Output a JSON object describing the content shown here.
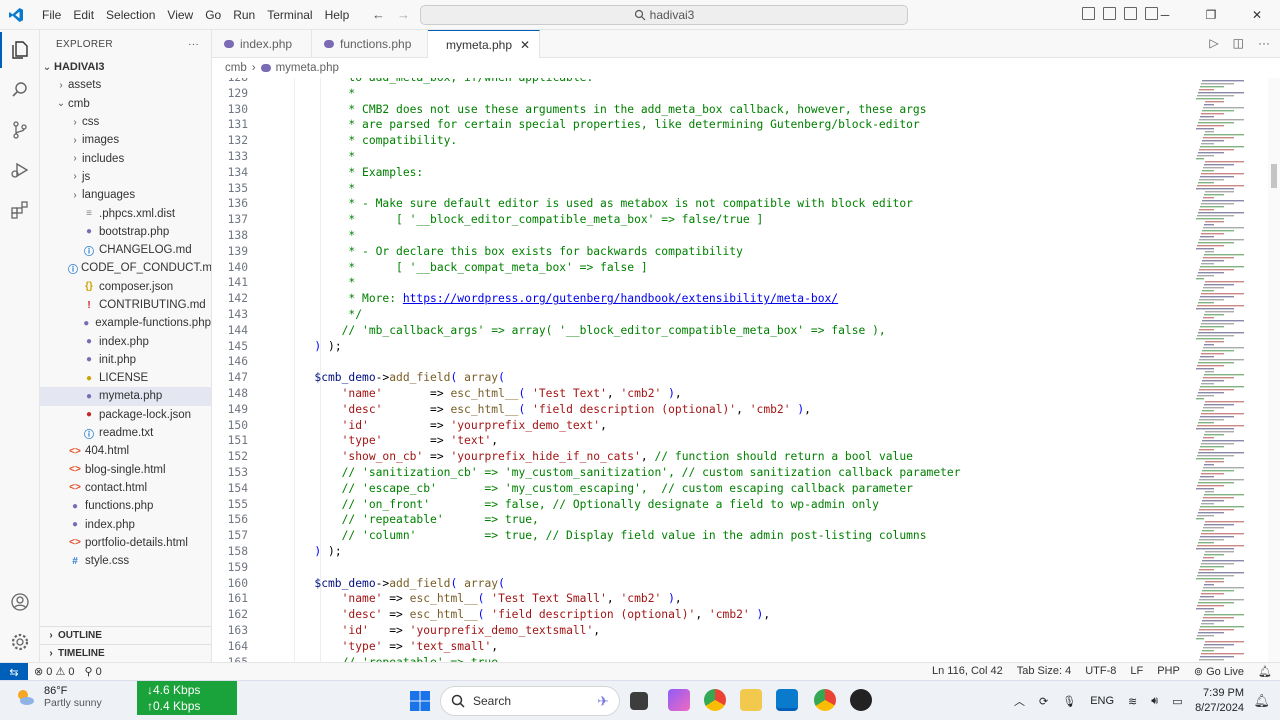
{
  "menu": [
    "File",
    "Edit",
    "Selection",
    "View",
    "Go",
    "Run",
    "Terminal",
    "Help"
  ],
  "command_center": "hadivai3",
  "explorer": {
    "title": "EXPLORER",
    "root": "HADIVAI3",
    "items": [
      {
        "label": "assets",
        "type": "folder",
        "depth": 1,
        "open": false
      },
      {
        "label": "cmb",
        "type": "folder",
        "depth": 1,
        "open": true
      },
      {
        "label": "css",
        "type": "folder",
        "depth": 2,
        "open": false
      },
      {
        "label": "images",
        "type": "folder",
        "depth": 2,
        "open": false
      },
      {
        "label": "includes",
        "type": "folder",
        "depth": 2,
        "open": false
      },
      {
        "label": "js",
        "type": "folder",
        "depth": 2,
        "open": false
      },
      {
        "label": "languages",
        "type": "folder",
        "depth": 2,
        "open": false
      },
      {
        "label": ".phpcs.xml.dist",
        "type": "file",
        "icon": "≡",
        "color": "#888",
        "depth": 2
      },
      {
        "label": "bootstrap.php",
        "type": "file",
        "icon": "●",
        "color": "#7b6bb5",
        "depth": 2
      },
      {
        "label": "CHANGELOG.md",
        "type": "file",
        "icon": "ⓘ",
        "color": "#2f7fd1",
        "depth": 2
      },
      {
        "label": "CODE_OF_CONDUCT.md",
        "type": "file",
        "icon": "ⓘ",
        "color": "#2f7fd1",
        "depth": 2
      },
      {
        "label": "composer.json",
        "type": "file",
        "icon": "{}",
        "color": "#c9a400",
        "depth": 2
      },
      {
        "label": "CONTRIBUTING.md",
        "type": "file",
        "icon": "!",
        "color": "#c62828",
        "depth": 2
      },
      {
        "label": "example-functions.php",
        "type": "file",
        "icon": "●",
        "color": "#7b6bb5",
        "depth": 2
      },
      {
        "label": "index.php",
        "type": "file",
        "icon": "●",
        "color": "#7b6bb5",
        "depth": 2
      },
      {
        "label": "init.php",
        "type": "file",
        "icon": "●",
        "color": "#7b6bb5",
        "depth": 2
      },
      {
        "label": "LICENSE",
        "type": "file",
        "icon": "●",
        "color": "#c9a400",
        "depth": 2
      },
      {
        "label": "mymeta.php",
        "type": "file",
        "icon": "●",
        "color": "#7b6bb5",
        "depth": 2,
        "selected": true
      },
      {
        "label": "package-lock.json",
        "type": "file",
        "icon": "●",
        "color": "#c62828",
        "depth": 2
      },
      {
        "label": "readme.txt",
        "type": "file",
        "icon": "ⓘ",
        "color": "#2f7fd1",
        "depth": 2
      },
      {
        "label": "404.html",
        "type": "file",
        "icon": "<>",
        "color": "#e44d26",
        "depth": 1
      },
      {
        "label": "blog-single.html",
        "type": "file",
        "icon": "<>",
        "color": "#e44d26",
        "depth": 1
      },
      {
        "label": "contact.html",
        "type": "file",
        "icon": "<>",
        "color": "#e44d26",
        "depth": 1
      },
      {
        "label": "functions.php",
        "type": "file",
        "icon": "●",
        "color": "#7b6bb5",
        "depth": 1
      },
      {
        "label": "index.php",
        "type": "file",
        "icon": "●",
        "color": "#7b6bb5",
        "depth": 1
      },
      {
        "label": "portfolio-details.html",
        "type": "file",
        "icon": "<>",
        "color": "#e44d26",
        "depth": 1
      },
      {
        "label": "style.css",
        "type": "file",
        "icon": "#",
        "color": "#2f7fd1",
        "depth": 1
      }
    ],
    "outline": "OUTLINE",
    "timeline": "TIMELINE"
  },
  "tabs": [
    {
      "label": "index.php",
      "active": false
    },
    {
      "label": "functions.php",
      "active": false
    },
    {
      "label": "mymeta.php",
      "active": true
    }
  ],
  "breadcrumb": [
    "cmb",
    "mymeta.php"
  ],
  "code_lines": [
    {
      "n": "128",
      "t": [
        [
          "c",
          "        to add_meta_box, if/when applicable."
        ]
      ]
    },
    {
      "n": "129",
      "t": [
        [
          "c",
          "        *"
        ]
      ]
    },
    {
      "n": "130",
      "t": [
        [
          "c",
          "        * CMB2 does not use these arguments in the add_meta_box callback, however, these args"
        ]
      ]
    },
    {
      "n": "131",
      "t": [
        [
          "c",
          "        * are parsed for certain special properties, like determining Gutenberg/block-editor"
        ]
      ]
    },
    {
      "n": "132",
      "t": [
        [
          "c",
          "        * compatibility."
        ]
      ]
    },
    {
      "n": "133",
      "t": [
        [
          "c",
          "        *"
        ]
      ]
    },
    {
      "n": "134",
      "t": [
        [
          "c",
          "        * Examples:"
        ]
      ]
    },
    {
      "n": "135",
      "t": [
        [
          "c",
          "        *"
        ]
      ]
    },
    {
      "n": "136",
      "t": [
        [
          "c",
          "        * - Make sure default editor is used as metabox is not compatible with block editor"
        ]
      ]
    },
    {
      "n": "137",
      "t": [
        [
          "c",
          "        *      [ '__block_editor_compatible_meta_box' => false/true ]"
        ]
      ]
    },
    {
      "n": "138",
      "t": [
        [
          "c",
          "        *"
        ]
      ]
    },
    {
      "n": "139",
      "t": [
        [
          "c",
          "        * - Or declare this box exists for backwards compatibility"
        ]
      ]
    },
    {
      "n": "140",
      "t": [
        [
          "c",
          "        *      [ '__back_compat_meta_box' => false ]"
        ]
      ]
    },
    {
      "n": "141",
      "t": [
        [
          "c",
          "        *"
        ]
      ]
    },
    {
      "n": "142",
      "t": [
        [
          "c",
          "        * More: "
        ],
        [
          "lnk",
          "https://wordpress.org/gutenberg/handbook/extensibility/meta-box/"
        ]
      ]
    },
    {
      "n": "143",
      "t": [
        [
          "c",
          "        */"
        ]
      ]
    },
    {
      "n": "144",
      "t": [
        [
          "c",
          "       // 'mb_callback_args' => array( '__block_editor_compatible_meta_box' => false ),"
        ]
      ]
    },
    {
      "n": "145",
      "t": [
        [
          "k",
          "   ) "
        ],
        [
          "o",
          ");"
        ]
      ]
    },
    {
      "n": "146",
      "t": []
    },
    {
      "n": "147",
      "t": [
        [
          "v",
          "   $cmb_demo"
        ],
        [
          "o",
          "->"
        ],
        [
          "f",
          "add_field"
        ],
        [
          "k",
          "( "
        ],
        [
          "f",
          "array"
        ],
        [
          "k",
          "("
        ]
      ]
    },
    {
      "n": "148",
      "t": [
        [
          "s",
          "       'name'"
        ],
        [
          "o",
          "       => "
        ],
        [
          "f",
          "esc_html__"
        ],
        [
          "k",
          "( "
        ],
        [
          "s",
          "'Test Text'"
        ],
        [
          "o",
          ", "
        ],
        [
          "s",
          "'cmb2'"
        ],
        [
          "k",
          " )"
        ],
        [
          "o",
          ","
        ]
      ]
    },
    {
      "n": "149",
      "t": [
        [
          "s",
          "       'desc'"
        ],
        [
          "o",
          "       => "
        ],
        [
          "f",
          "esc_html__"
        ],
        [
          "k",
          "( "
        ],
        [
          "s",
          "'field description (optional)'"
        ],
        [
          "o",
          ", "
        ],
        [
          "s",
          "'cmb2'"
        ],
        [
          "k",
          " )"
        ],
        [
          "o",
          ","
        ]
      ]
    },
    {
      "n": "150",
      "t": [
        [
          "s",
          "       'id'"
        ],
        [
          "o",
          "         => "
        ],
        [
          "s",
          "'yourprefix_demo_text'"
        ],
        [
          "o",
          ","
        ]
      ]
    },
    {
      "n": "151",
      "t": [
        [
          "s",
          "       'type'"
        ],
        [
          "o",
          "       => "
        ],
        [
          "s",
          "'text'"
        ],
        [
          "o",
          ","
        ]
      ]
    },
    {
      "n": "152",
      "t": [
        [
          "s",
          "       'show_on_cb'"
        ],
        [
          "o",
          " => "
        ],
        [
          "s",
          "'yourprefix_hide_if_no_cats'"
        ],
        [
          "o",
          ", "
        ],
        [
          "c",
          "// function should return a bool value"
        ]
      ]
    },
    {
      "n": "153",
      "t": [
        [
          "c",
          "       // 'sanitization_cb' => 'my_custom_sanitization', // custom sanitization callback parameter"
        ]
      ]
    },
    {
      "n": "154",
      "t": [
        [
          "c",
          "       // 'escape_cb'       => 'my_custom_escaping',  // custom escaping callback parameter"
        ]
      ]
    },
    {
      "n": "155",
      "t": [
        [
          "c",
          "       // 'on_front'        => false, // Optionally designate a field to wp-admin only"
        ]
      ]
    },
    {
      "n": "156",
      "t": [
        [
          "c",
          "       // 'repeatable'      => true,"
        ]
      ]
    },
    {
      "n": "157",
      "t": [
        [
          "c",
          "       // 'column'          => true, // Display field value in the admin post-listing columns"
        ]
      ]
    },
    {
      "n": "158",
      "t": [
        [
          "k",
          "   ) "
        ],
        [
          "o",
          ");"
        ]
      ]
    },
    {
      "n": "159",
      "t": []
    },
    {
      "n": "160",
      "t": [
        [
          "v",
          "   $cmb_demo"
        ],
        [
          "o",
          "->"
        ],
        [
          "f",
          "add_field"
        ],
        [
          "k",
          "( "
        ],
        [
          "f",
          "array"
        ],
        [
          "k",
          "("
        ]
      ]
    },
    {
      "n": "161",
      "t": [
        [
          "s",
          "       'name'"
        ],
        [
          "o",
          " => "
        ],
        [
          "f",
          "esc_html__"
        ],
        [
          "k",
          "( "
        ],
        [
          "s",
          "'Test Text Small'"
        ],
        [
          "o",
          ", "
        ],
        [
          "s",
          "'cmb2'"
        ],
        [
          "k",
          " )"
        ],
        [
          "o",
          ","
        ]
      ]
    },
    {
      "n": "162",
      "t": [
        [
          "s",
          "       'desc'"
        ],
        [
          "o",
          " => "
        ],
        [
          "f",
          "esc_html__"
        ],
        [
          "k",
          "( "
        ],
        [
          "s",
          "'field description (optional)'"
        ],
        [
          "o",
          ", "
        ],
        [
          "s",
          "'cmb2'"
        ],
        [
          "k",
          " )"
        ],
        [
          "o",
          ","
        ]
      ]
    },
    {
      "n": "163",
      "t": [
        [
          "s",
          "       'id'"
        ],
        [
          "o",
          "   => "
        ],
        [
          "s",
          "'yourprefix_demo_textsmall'"
        ],
        [
          "o",
          ","
        ]
      ]
    },
    {
      "n": "164",
      "t": [
        [
          "s",
          "       'type'"
        ],
        [
          "o",
          " => "
        ],
        [
          "s",
          "'text_small'"
        ],
        [
          "o",
          ","
        ]
      ]
    },
    {
      "n": "165",
      "t": [
        [
          "c",
          "       // 'repeatable' => true,"
        ]
      ]
    }
  ],
  "status": {
    "errors": "0",
    "warnings": "0",
    "ports": "0",
    "position": "Ln 116, Col 42",
    "tab_size": "Tab Size: 4",
    "encoding": "UTF-8",
    "eol": "LF",
    "language": "PHP",
    "golive": "Go Live"
  },
  "taskbar": {
    "temp": "86°F",
    "weather": "Partly sunny",
    "net_down": "4.6 Kbps",
    "net_up": "0.4 Kbps",
    "search": "Search",
    "lang": "ENG",
    "time": "7:39 PM",
    "date": "8/27/2024"
  }
}
